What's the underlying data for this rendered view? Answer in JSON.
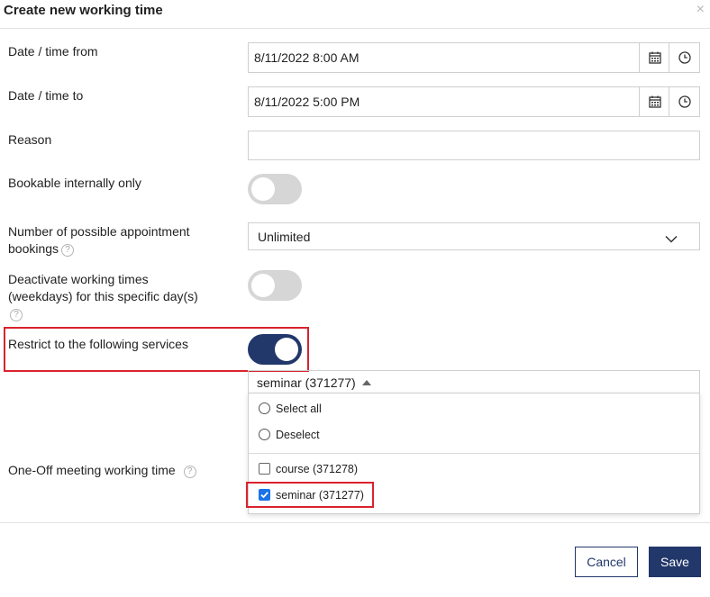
{
  "dialog": {
    "title": "Create new working time",
    "close_symbol": "×"
  },
  "fields": {
    "date_from": {
      "label": "Date / time from",
      "value": "8/11/2022 8:00 AM"
    },
    "date_to": {
      "label": "Date / time to",
      "value": "8/11/2022 5:00 PM"
    },
    "reason": {
      "label": "Reason",
      "value": ""
    },
    "bookable_internally": {
      "label": "Bookable internally only",
      "on": false
    },
    "possible_bookings": {
      "label_line1": "Number of possible appointment",
      "label_line2": "bookings",
      "value": "Unlimited"
    },
    "deactivate_weekdays": {
      "label_line1": "Deactivate working times",
      "label_line2": "(weekdays) for this specific day(s)",
      "on": false
    },
    "restrict_services": {
      "label": "Restrict to the following services",
      "on": true
    },
    "one_off": {
      "label": "One-Off meeting working time"
    }
  },
  "help_symbol": "?",
  "services_multiselect": {
    "selected_text": "seminar (371277)",
    "select_all": "Select all",
    "deselect": "Deselect",
    "options": [
      {
        "label": "course (371278)",
        "checked": false
      },
      {
        "label": "seminar (371277)",
        "checked": true
      }
    ]
  },
  "buttons": {
    "cancel": "Cancel",
    "save": "Save"
  },
  "colors": {
    "primary": "#22376a",
    "highlight": "#d9232e",
    "checkbox_blue": "#1a73e8"
  },
  "icons": [
    "calendar-icon",
    "clock-icon",
    "chevron-down-icon",
    "help-icon",
    "close-icon"
  ]
}
